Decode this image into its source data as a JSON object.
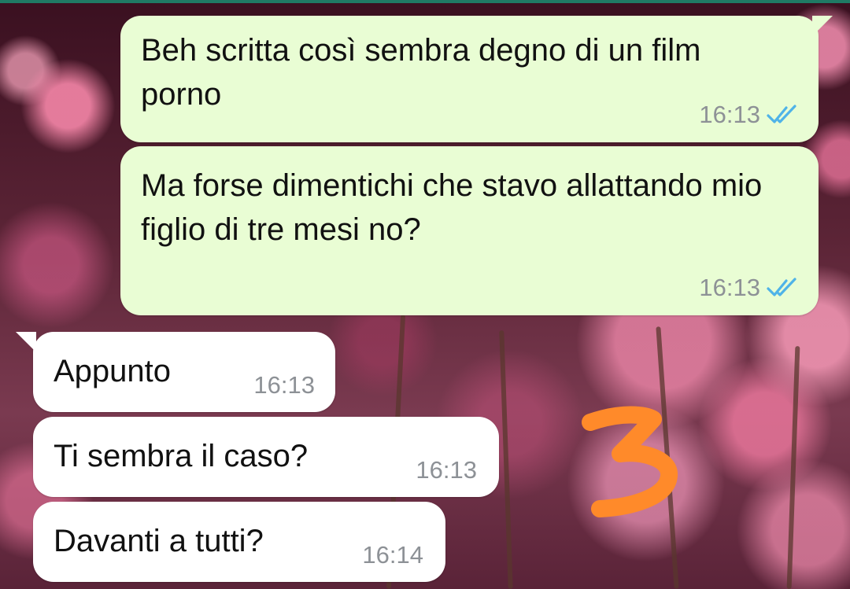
{
  "chat": {
    "messages": [
      {
        "direction": "outgoing",
        "text": "Beh scritta così sembra degno di un film porno",
        "time": "16:13",
        "status": "read",
        "tick_color": "#4fb3e8"
      },
      {
        "direction": "outgoing",
        "text": "Ma forse dimentichi che stavo allattando mio figlio di tre mesi no?",
        "time": "16:13",
        "status": "read",
        "tick_color": "#4fb3e8"
      },
      {
        "direction": "incoming",
        "text": "Appunto",
        "time": "16:13"
      },
      {
        "direction": "incoming",
        "text": "Ti sembra il caso?",
        "time": "16:13"
      },
      {
        "direction": "incoming",
        "text": "Davanti a tutti?",
        "time": "16:14"
      }
    ]
  },
  "annotation": {
    "text": "3",
    "color": "#ff8a2a"
  },
  "colors": {
    "outgoing_bubble": "#e9fdd4",
    "incoming_bubble": "#ffffff",
    "timestamp": "#8d9196"
  }
}
